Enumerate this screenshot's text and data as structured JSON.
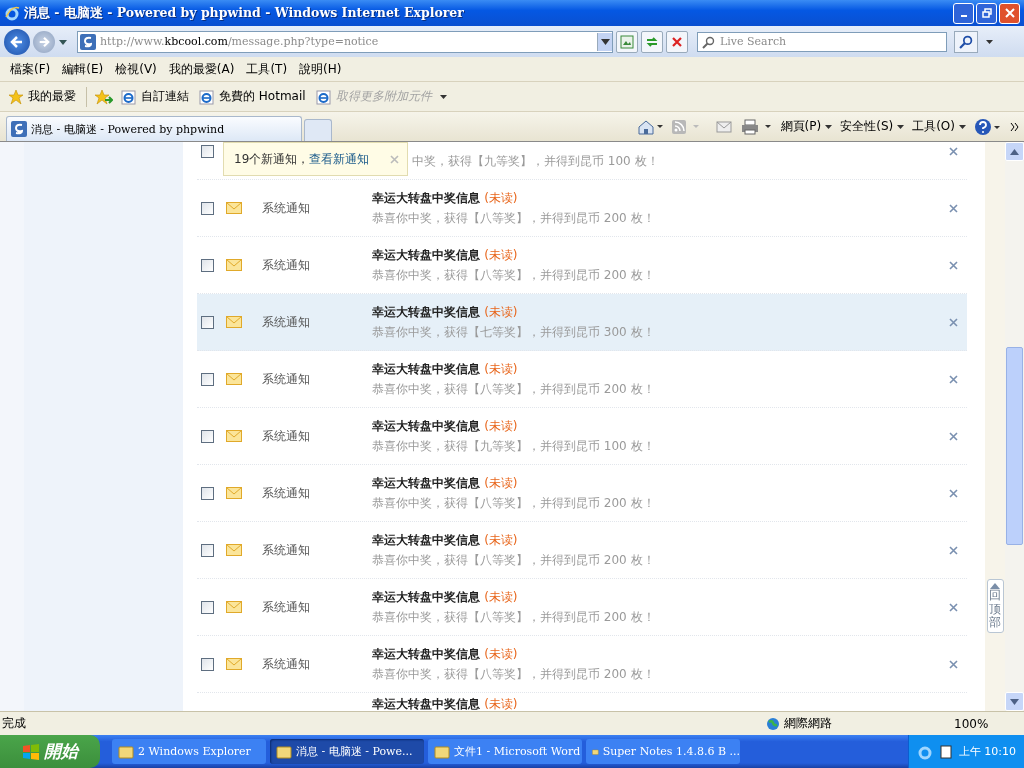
{
  "window": {
    "title": "消息 - 电脑迷 - Powered by phpwind - Windows Internet Explorer"
  },
  "address": {
    "prefix": "http://www.",
    "domain": "kbcool.com",
    "path": "/message.php?type=notice"
  },
  "search": {
    "placeholder": "Live Search"
  },
  "menu": [
    "檔案(F)",
    "編輯(E)",
    "檢視(V)",
    "我的最愛(A)",
    "工具(T)",
    "說明(H)"
  ],
  "favorites_bar": {
    "favorites": "我的最愛",
    "links": [
      {
        "label": "自訂連結",
        "disabled": false
      },
      {
        "label": "免費的 Hotmail",
        "disabled": false
      },
      {
        "label": "取得更多附加元件",
        "disabled": true
      }
    ]
  },
  "tab": {
    "title": "消息 - 电脑迷 - Powered by phpwind"
  },
  "command_bar": [
    "網頁(P)",
    "安全性(S)",
    "工具(O)"
  ],
  "notice_popup": {
    "count_text": "19个新通知，",
    "link": "查看新通知"
  },
  "messages": [
    {
      "kind": "partial",
      "checked": false,
      "highlighted": false,
      "body": "中奖，获得【九等奖】，并得到昆币 100 枚！"
    },
    {
      "kind": "full",
      "checked": false,
      "highlighted": false,
      "sender": "系统通知",
      "title": "幸运大转盘中奖信息",
      "unread": "(未读)",
      "body": "恭喜你中奖，获得【八等奖】，并得到昆币 200 枚！"
    },
    {
      "kind": "full",
      "checked": false,
      "highlighted": false,
      "sender": "系统通知",
      "title": "幸运大转盘中奖信息",
      "unread": "(未读)",
      "body": "恭喜你中奖，获得【八等奖】，并得到昆币 200 枚！"
    },
    {
      "kind": "full",
      "checked": false,
      "highlighted": true,
      "sender": "系统通知",
      "title": "幸运大转盘中奖信息",
      "unread": "(未读)",
      "body": "恭喜你中奖，获得【七等奖】，并得到昆币 300 枚！"
    },
    {
      "kind": "full",
      "checked": false,
      "highlighted": false,
      "sender": "系统通知",
      "title": "幸运大转盘中奖信息",
      "unread": "(未读)",
      "body": "恭喜你中奖，获得【八等奖】，并得到昆币 200 枚！"
    },
    {
      "kind": "full",
      "checked": false,
      "highlighted": false,
      "sender": "系统通知",
      "title": "幸运大转盘中奖信息",
      "unread": "(未读)",
      "body": "恭喜你中奖，获得【九等奖】，并得到昆币 100 枚！"
    },
    {
      "kind": "full",
      "checked": false,
      "highlighted": false,
      "sender": "系统通知",
      "title": "幸运大转盘中奖信息",
      "unread": "(未读)",
      "body": "恭喜你中奖，获得【八等奖】，并得到昆币 200 枚！"
    },
    {
      "kind": "full",
      "checked": false,
      "highlighted": false,
      "sender": "系统通知",
      "title": "幸运大转盘中奖信息",
      "unread": "(未读)",
      "body": "恭喜你中奖，获得【八等奖】，并得到昆币 200 枚！"
    },
    {
      "kind": "full",
      "checked": false,
      "highlighted": false,
      "sender": "系统通知",
      "title": "幸运大转盘中奖信息",
      "unread": "(未读)",
      "body": "恭喜你中奖，获得【八等奖】，并得到昆币 200 枚！"
    },
    {
      "kind": "full",
      "checked": false,
      "highlighted": false,
      "sender": "系统通知",
      "title": "幸运大转盘中奖信息",
      "unread": "(未读)",
      "body": "恭喜你中奖，获得【八等奖】，并得到昆币 200 枚！"
    },
    {
      "kind": "cut",
      "title": "幸运大转盘中奖信息",
      "unread": "(未读)"
    }
  ],
  "back_to_top": "回顶部",
  "status_bar": {
    "text": "完成",
    "zone": "網際網路",
    "zoom": "100%"
  },
  "taskbar": {
    "start": "開始",
    "tasks": [
      {
        "label": "2 Windows Explorer",
        "selected": false
      },
      {
        "label": "消息 - 电脑迷 - Powe...",
        "selected": true
      },
      {
        "label": "文件1 - Microsoft Word",
        "selected": false
      },
      {
        "label": "Super Notes 1.4.8.6 B ...",
        "selected": false
      }
    ],
    "clock": "上午 10:10"
  }
}
